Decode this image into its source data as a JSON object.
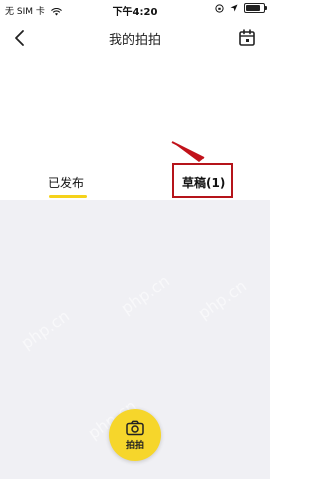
{
  "status_bar": {
    "carrier_prefix": "无 SIM 卡",
    "time": "下午4:20",
    "battery_level": 0.8,
    "icons": [
      "wifi-icon",
      "orientation-lock-icon",
      "location-icon",
      "battery-icon"
    ]
  },
  "nav": {
    "title": "我的拍拍",
    "back_icon": "chevron-left-icon",
    "action_icon": "calendar-icon"
  },
  "tabs": [
    {
      "label": "已发布",
      "active": true
    },
    {
      "label": "草稿(1)",
      "active": false
    }
  ],
  "watermarks": [
    "php.cn",
    "php.cn",
    "php.cn",
    "php.cn"
  ],
  "shoot_button": {
    "label": "拍拍",
    "icon": "camera-icon"
  },
  "colors": {
    "accent_yellow": "#f6d62b",
    "highlight_red": "#b5141a",
    "content_bg": "#f0f0f4"
  }
}
